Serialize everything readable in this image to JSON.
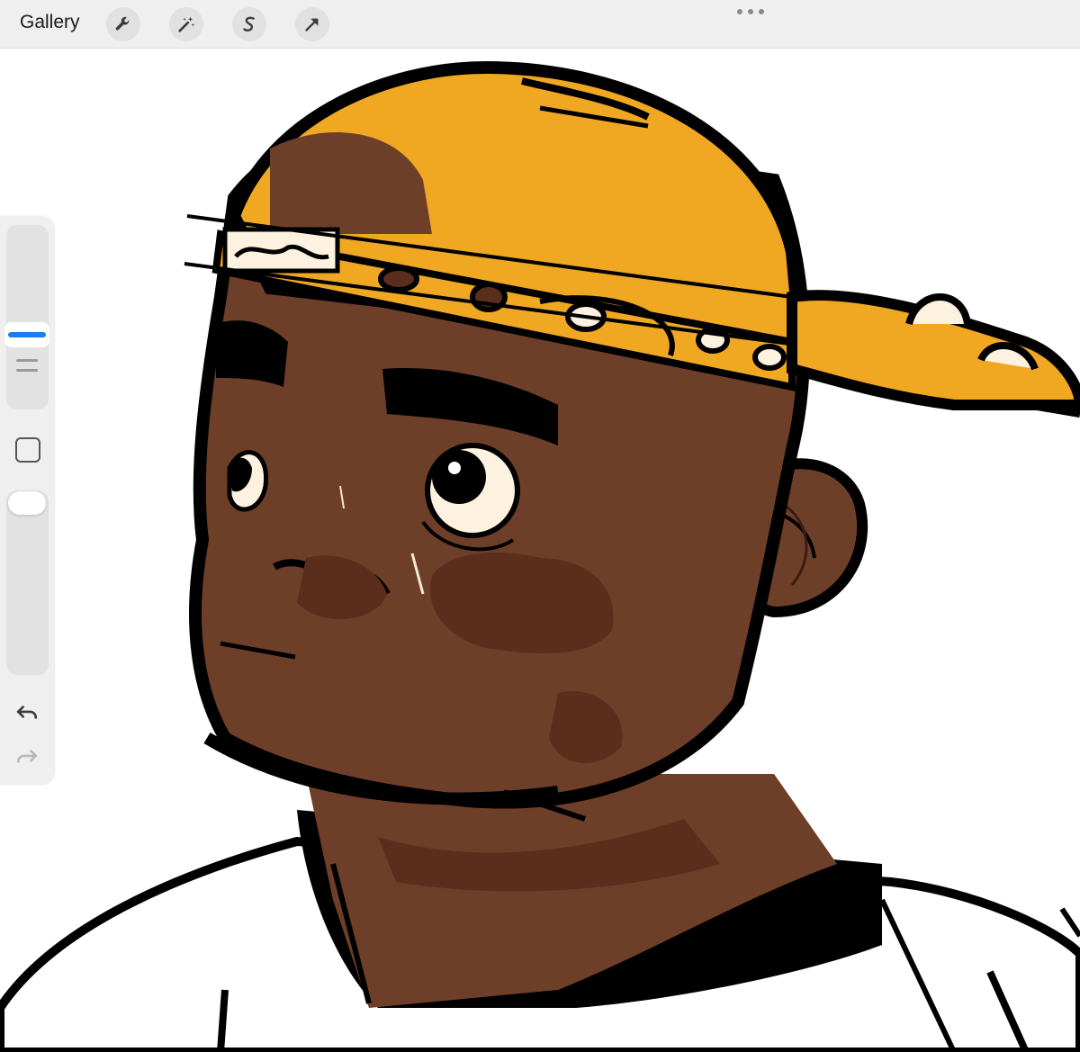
{
  "toolbar": {
    "gallery_label": "Gallery",
    "tools": [
      {
        "icon": "wrench-icon"
      },
      {
        "icon": "magic-wand-icon"
      },
      {
        "icon": "selection-s-icon"
      },
      {
        "icon": "arrow-transform-icon"
      }
    ],
    "more_icon": "ellipsis-icon"
  },
  "sidebar": {
    "brush_size_slider_icon": "brush-size-slider",
    "modify_button_icon": "square-icon",
    "opacity_slider_icon": "opacity-slider",
    "undo_icon": "undo-icon",
    "redo_icon": "redo-icon"
  },
  "colors": {
    "toolbar_bg": "#efefef",
    "accent": "#1f7cf2",
    "skin": "#6e3f28",
    "skin_shadow": "#5a2d1d",
    "cap": "#f0a822",
    "outline": "#000000",
    "eye": "#fdf1e0"
  }
}
